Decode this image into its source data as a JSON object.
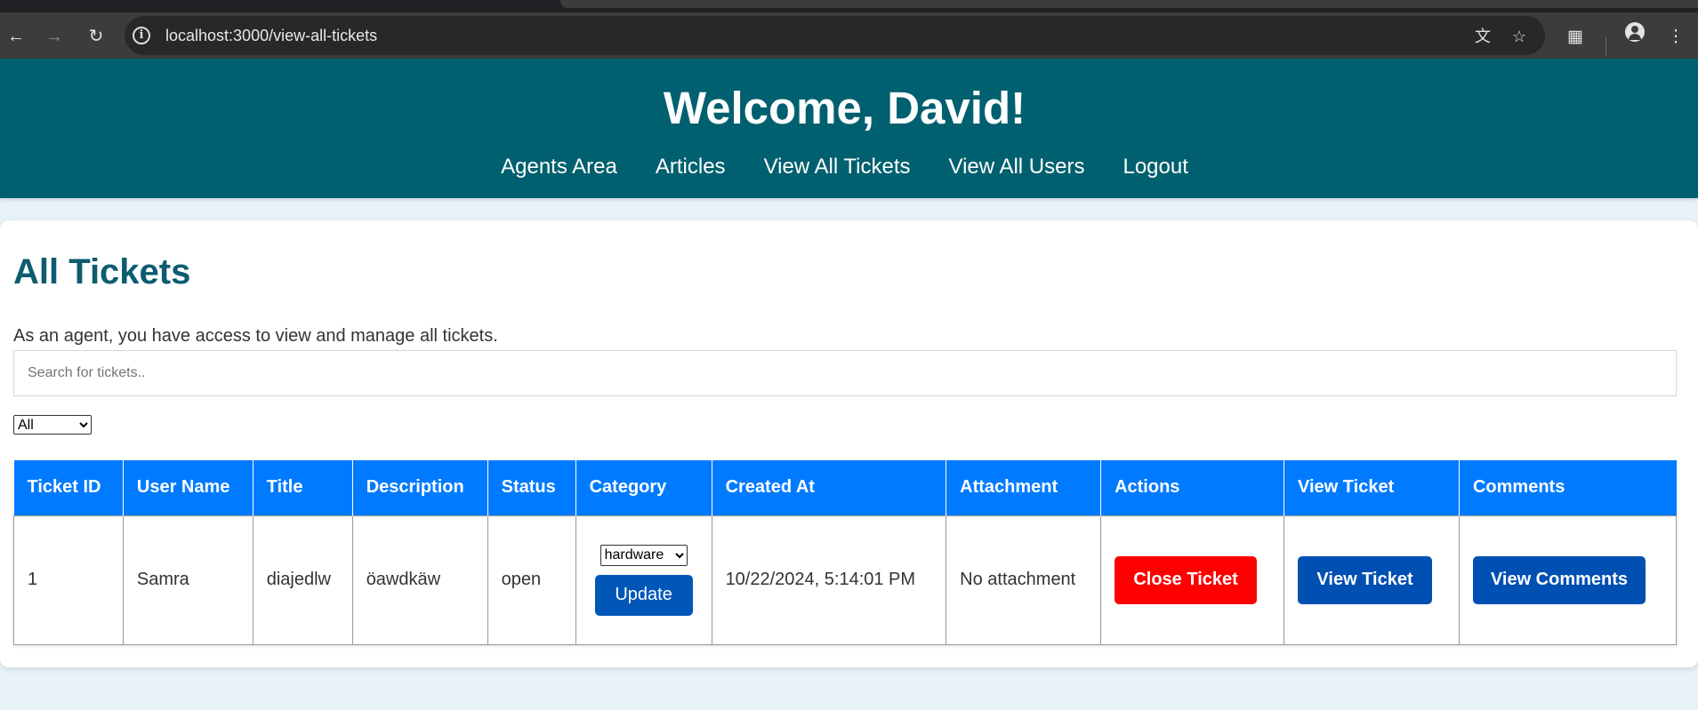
{
  "browser": {
    "url": "localhost:3000/view-all-tickets",
    "icons": {
      "back": "back-arrow-icon",
      "forward": "forward-arrow-icon",
      "reload": "reload-icon",
      "info": "site-info-icon",
      "translate": "translate-icon",
      "bookmark": "bookmark-star-icon",
      "extensions": "extensions-icon",
      "profile": "profile-icon",
      "menu": "menu-kebab-icon"
    }
  },
  "header": {
    "welcome": "Welcome, David!",
    "nav": {
      "agents_area": "Agents Area",
      "articles": "Articles",
      "view_all_tickets": "View All Tickets",
      "view_all_users": "View All Users",
      "logout": "Logout"
    },
    "bg_color": "#00606f"
  },
  "main": {
    "title": "All Tickets",
    "intro": "As an agent, you have access to view and manage all tickets.",
    "search_placeholder": "Search for tickets..",
    "search_value": "",
    "filter_selected": "All",
    "table": {
      "headers": [
        "Ticket ID",
        "User Name",
        "Title",
        "Description",
        "Status",
        "Category",
        "Created At",
        "Attachment",
        "Actions",
        "View Ticket",
        "Comments"
      ],
      "header_color": "#007bff",
      "rows": [
        {
          "ticket_id": "1",
          "user_name": "Samra",
          "title": "diajedlw",
          "description": "öawdkäw",
          "status": "open",
          "category_selected": "hardware",
          "update_label": "Update",
          "created_at": "10/22/2024, 5:14:01 PM",
          "attachment": "No attachment",
          "close_label": "Close Ticket",
          "view_label": "View Ticket",
          "comments_label": "View Comments"
        }
      ]
    }
  },
  "colors": {
    "title": "#0d5c70",
    "close_button": "#ff0000",
    "primary_button": "#0050b3",
    "page_bg": "#e8f3f8"
  }
}
